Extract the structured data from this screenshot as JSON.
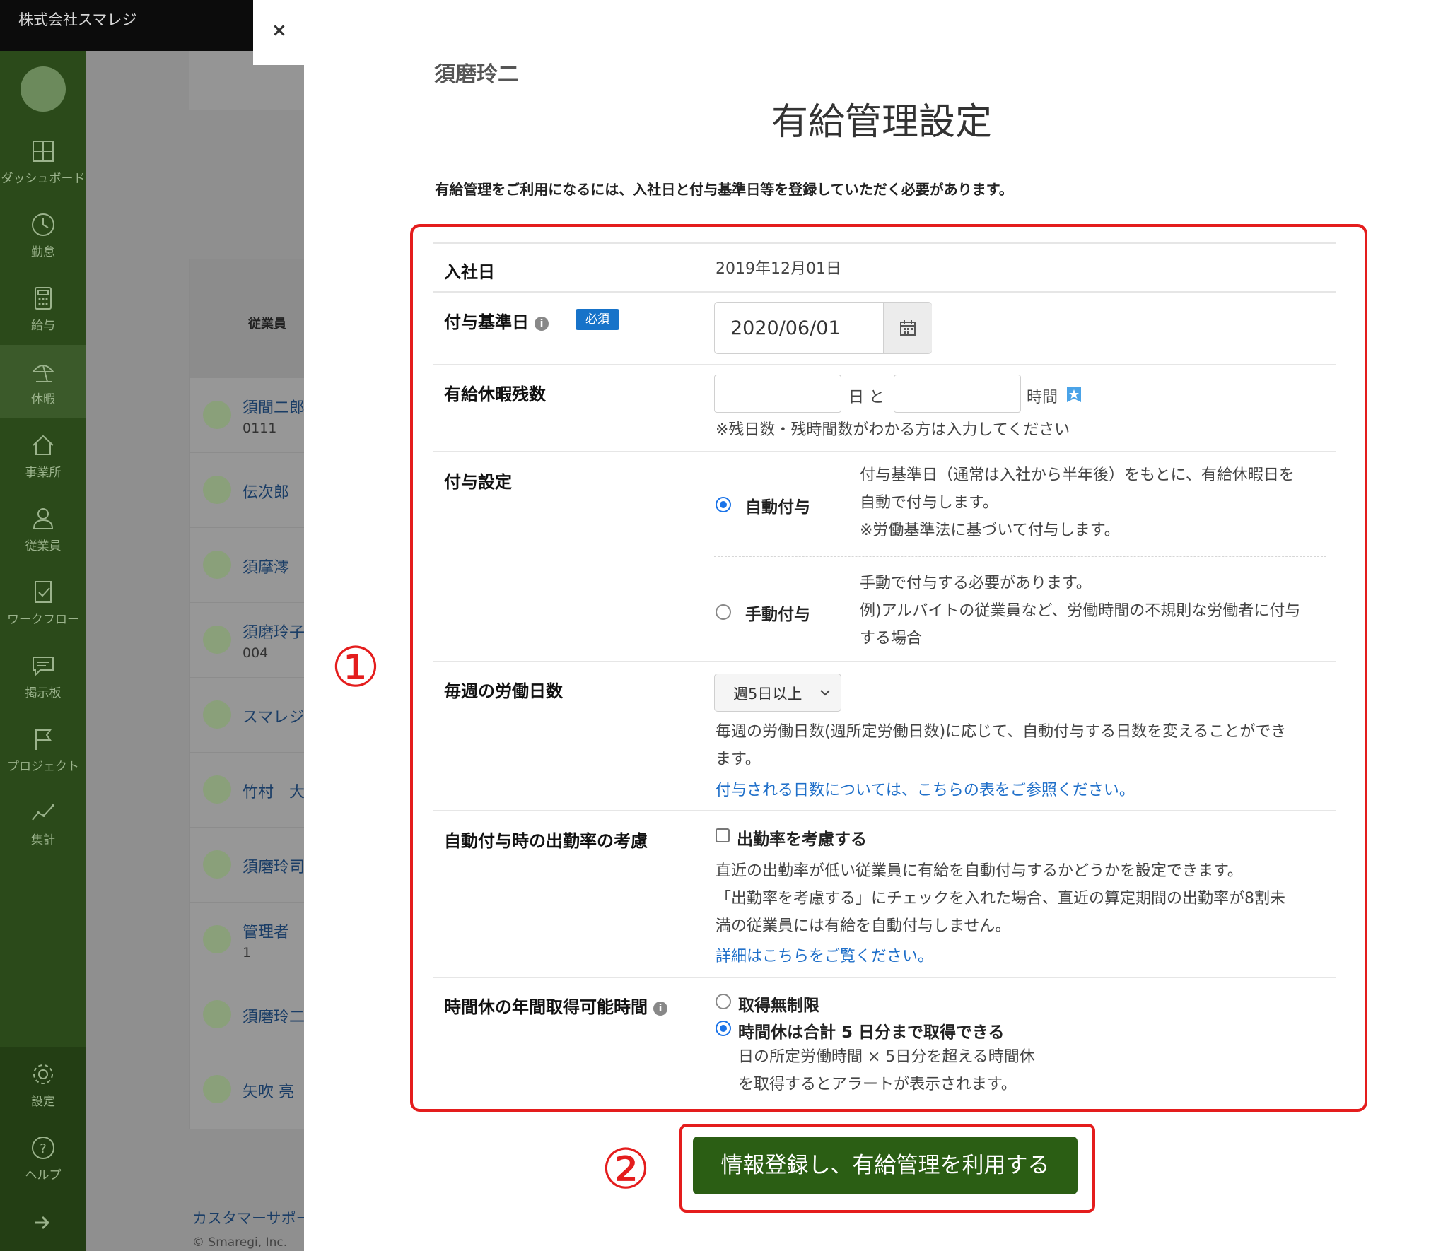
{
  "app": {
    "company": "株式会社スマレジ"
  },
  "sidebar": {
    "items": [
      {
        "label": "ダッシュボード",
        "icon": "dashboard-icon"
      },
      {
        "label": "勤怠",
        "icon": "clock-icon"
      },
      {
        "label": "給与",
        "icon": "calculator-icon"
      },
      {
        "label": "休暇",
        "icon": "beach-umbrella-icon"
      },
      {
        "label": "事業所",
        "icon": "home-icon"
      },
      {
        "label": "従業員",
        "icon": "person-icon"
      },
      {
        "label": "ワークフロー",
        "icon": "document-check-icon"
      },
      {
        "label": "掲示板",
        "icon": "chat-icon"
      },
      {
        "label": "プロジェクト",
        "icon": "flag-icon"
      },
      {
        "label": "集計",
        "icon": "line-chart-icon"
      }
    ],
    "bottom_items": [
      {
        "label": "設定",
        "icon": "gear-icon"
      },
      {
        "label": "ヘルプ",
        "icon": "help-icon"
      }
    ],
    "collapse_icon": "arrow-right-icon"
  },
  "background": {
    "table_header": "従業員",
    "rows": [
      {
        "name": "須間二郎",
        "code": "0111"
      },
      {
        "name": "伝次郎",
        "code": ""
      },
      {
        "name": "須摩澪",
        "code": ""
      },
      {
        "name": "須磨玲子",
        "code": "004"
      },
      {
        "name": "スマレジ",
        "code": ""
      },
      {
        "name": "竹村　大",
        "code": ""
      },
      {
        "name": "須磨玲司",
        "code": ""
      },
      {
        "name": "管理者",
        "code": "1"
      },
      {
        "name": "須磨玲二",
        "code": ""
      },
      {
        "name": "矢吹 亮",
        "code": ""
      }
    ],
    "footer_link": "カスタマーサポート",
    "copyright": "© Smaregi, Inc."
  },
  "modal": {
    "close_label": "×",
    "person_name": "須磨玲二",
    "title": "有給管理設定",
    "intro": "有給管理をご利用になるには、入社日と付与基準日等を登録していただく必要があります。",
    "annotations": {
      "box1": "①",
      "box2": "②"
    },
    "hire_date": {
      "label": "入社日",
      "value": "2019年12月01日"
    },
    "grant_base_date": {
      "label": "付与基準日",
      "required": "必須",
      "value": "2020/06/01",
      "icon": "calendar-icon"
    },
    "remaining": {
      "label": "有給休暇残数",
      "days_value": "",
      "days_unit": "日 と",
      "hours_value": "",
      "hours_unit": "時間",
      "note": "※残日数・残時間数がわかる方は入力してください",
      "icon": "star-badge-icon"
    },
    "grant_setting": {
      "label": "付与設定",
      "auto": {
        "label": "自動付与",
        "selected": true,
        "desc": [
          "付与基準日（通常は入社から半年後）をもとに、有給休暇日を",
          "自動で付与します。",
          "※労働基準法に基づいて付与します。"
        ]
      },
      "manual": {
        "label": "手動付与",
        "selected": false,
        "desc": [
          "手動で付与する必要があります。",
          "例)アルバイトの従業員など、労働時間の不規則な労働者に付与",
          "する場合"
        ]
      }
    },
    "weekly_days": {
      "label": "毎週の労働日数",
      "selected": "週5日以上",
      "desc": [
        "毎週の労働日数(週所定労働日数)に応じて、自動付与する日数を変えることができ",
        "ます。"
      ],
      "link": "付与される日数については、こちらの表をご参照ください。"
    },
    "attendance": {
      "label": "自動付与時の出勤率の考慮",
      "checkbox_label": "出勤率を考慮する",
      "checked": false,
      "desc": [
        "直近の出勤率が低い従業員に有給を自動付与するかどうかを設定できます。",
        "「出勤率を考慮する」にチェックを入れた場合、直近の算定期間の出勤率が8割未",
        "満の従業員には有給を自動付与しません。"
      ],
      "link": "詳細はこちらをご覧ください。"
    },
    "hourly_leave": {
      "label": "時間休の年間取得可能時間",
      "unlimited": {
        "label": "取得無制限",
        "selected": false
      },
      "limited": {
        "label": "時間休は合計 5 日分まで取得できる",
        "selected": true
      },
      "desc": [
        "日の所定労働時間 × 5日分を超える時間休",
        "を取得するとアラートが表示されます。"
      ]
    },
    "submit_label": "情報登録し、有給管理を利用する",
    "colors": {
      "accent": "#2b5e14",
      "highlight": "#e41d1d",
      "link": "#1f6fc9",
      "badge": "#1773c9"
    }
  }
}
